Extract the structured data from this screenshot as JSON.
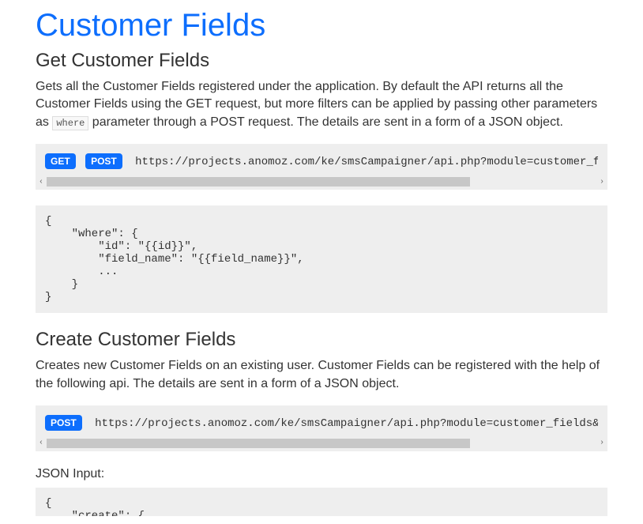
{
  "page_title": "Customer Fields",
  "sections": {
    "get": {
      "heading": "Get Customer Fields",
      "desc_pre": "Gets all the Customer Fields registered under the application. By default the API returns all the Customer Fields using the GET request, but more filters can be applied by passing other parameters as ",
      "code_inline": "where",
      "desc_post": " parameter through a POST request. The details are sent in a form of a JSON object.",
      "badges": {
        "get": "GET",
        "post": "POST"
      },
      "endpoint": "https://projects.anomoz.com/ke/smsCampaigner/api.php?module=customer_fields&action=get&client_api={{client_api_key}}",
      "json_body": "{\n    \"where\": {\n        \"id\": \"{{id}}\",\n        \"field_name\": \"{{field_name}}\",\n        ...\n    }\n}"
    },
    "create": {
      "heading": "Create Customer Fields",
      "desc": "Creates new Customer Fields on an existing user. Customer Fields can be registered with the help of the following api. The details are sent in a form of a JSON object.",
      "badges": {
        "post": "POST"
      },
      "endpoint": "https://projects.anomoz.com/ke/smsCampaigner/api.php?module=customer_fields&action=create&client_api={{client_api_key}}",
      "json_label": "JSON Input:",
      "json_partial": "{\n    \"create\": {"
    }
  },
  "chevrons": {
    "left": "‹",
    "right": "›"
  }
}
